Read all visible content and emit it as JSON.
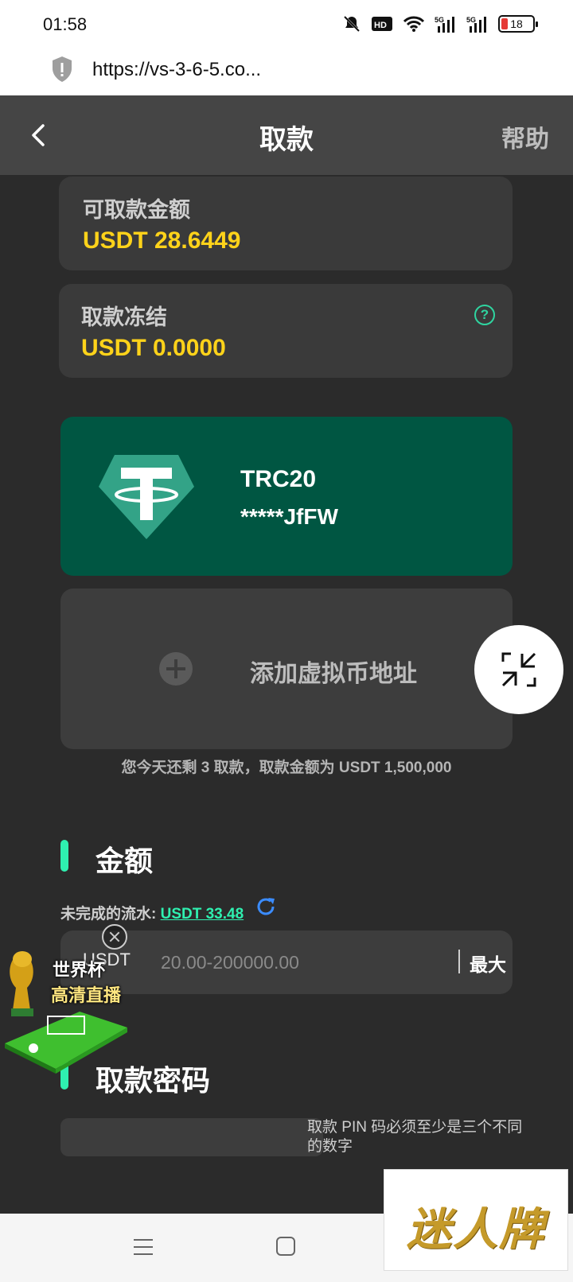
{
  "status_bar": {
    "time": "01:58",
    "battery": "18"
  },
  "browser": {
    "url": "https://vs-3-6-5.co..."
  },
  "header": {
    "title": "取款",
    "help_label": "帮助"
  },
  "balances": {
    "available_label": "可取款金额",
    "available_value": "USDT 28.6449",
    "frozen_label": "取款冻结",
    "frozen_value": "USDT 0.0000"
  },
  "wallet": {
    "network": "TRC20",
    "address": "*****JfFW",
    "icon": "tether-icon",
    "color": "#005642"
  },
  "add_address": {
    "label": "添加虚拟币地址"
  },
  "remaining_note": "您今天还剩 3 取款，取款金额为 USDT 1,500,000",
  "amount_section": {
    "title": "金额",
    "turnover_label": "未完成的流水: ",
    "turnover_value": "USDT 33.48",
    "currency": "USDT",
    "placeholder": "20.00-200000.00",
    "max_label": "最大"
  },
  "pin_section": {
    "title": "取款密码",
    "hint": "取款 PIN 码必须至少是三个不同的数字"
  },
  "promo": {
    "line1": "世界杯",
    "line2": "高清直播"
  },
  "watermark": {
    "text": "迷人牌"
  },
  "colors": {
    "accent": "#2ff0b0",
    "amount": "#ffd31a",
    "background": "#2b2b2b"
  }
}
